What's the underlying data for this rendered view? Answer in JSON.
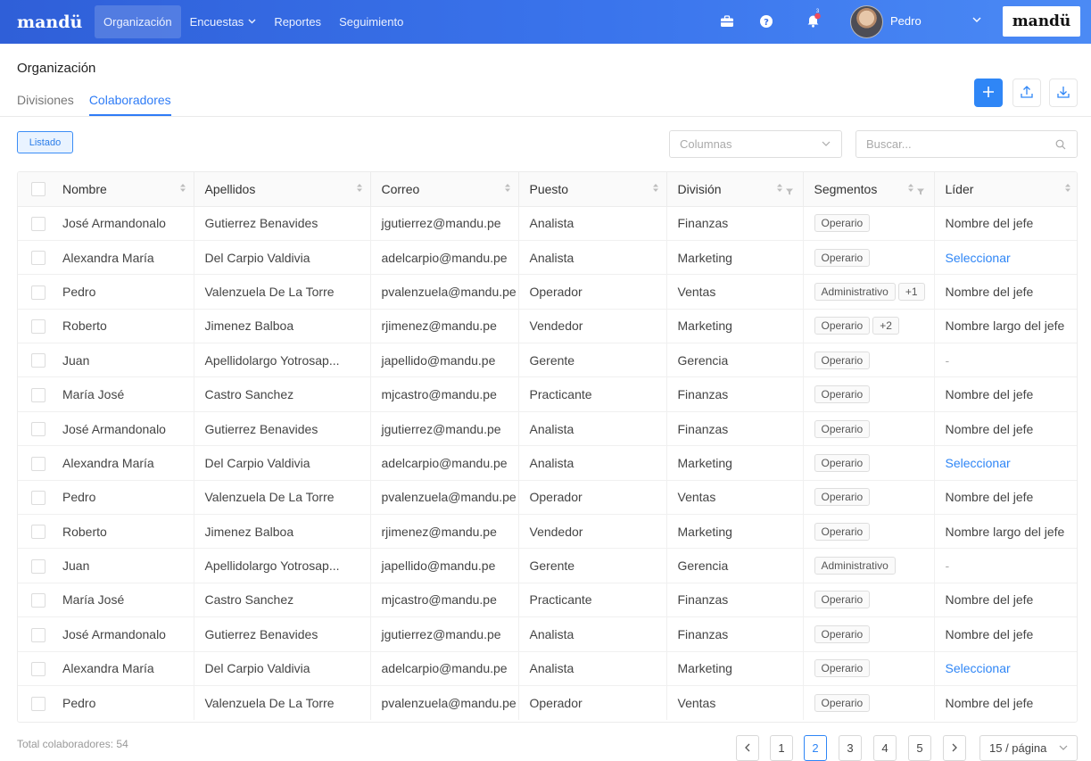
{
  "topbar": {
    "logo": "mandü",
    "nav": [
      {
        "label": "Organización",
        "active": true
      },
      {
        "label": "Encuestas",
        "chevron": "⌄"
      },
      {
        "label": "Reportes"
      },
      {
        "label": "Seguimiento"
      }
    ],
    "notification_badge": "3",
    "user_name": "Pedro",
    "brand_logo": "mandü",
    "colors": {
      "gradient_start": "#2f5fd8",
      "gradient_end": "#4b8af5"
    },
    "icons": [
      "briefcase-icon",
      "help-icon",
      "bell-icon",
      "avatar",
      "chevron-down-icon"
    ]
  },
  "page": {
    "title": "Organización",
    "tabs": [
      {
        "label": "Divisiones",
        "active": false
      },
      {
        "label": "Colaboradores",
        "active": true
      }
    ],
    "actions": [
      "add-icon",
      "upload-icon",
      "download-icon"
    ]
  },
  "toolbar": {
    "view_button": "Listado",
    "columns_select": "Columnas",
    "search_placeholder": "Buscar..."
  },
  "table": {
    "headers": [
      "Nombre",
      "Apellidos",
      "Correo",
      "Puesto",
      "División",
      "Segmentos",
      "Líder"
    ],
    "rows": [
      {
        "nombre": "José Armandonalo",
        "apellidos": "Gutierrez Benavides",
        "correo": "jgutierrez@mandu.pe",
        "puesto": "Analista",
        "division": "Finanzas",
        "segmentos": [
          "Operario"
        ],
        "lider": "Nombre del jefe",
        "lider_type": "text"
      },
      {
        "nombre": "Alexandra María",
        "apellidos": "Del Carpio Valdivia",
        "correo": "adelcarpio@mandu.pe",
        "puesto": "Analista",
        "division": "Marketing",
        "segmentos": [
          "Operario"
        ],
        "lider": "Seleccionar",
        "lider_type": "link"
      },
      {
        "nombre": "Pedro",
        "apellidos": "Valenzuela De La Torre",
        "correo": "pvalenzuela@mandu.pe",
        "puesto": "Operador",
        "division": "Ventas",
        "segmentos": [
          "Administrativo",
          "+1"
        ],
        "lider": "Nombre del jefe",
        "lider_type": "text"
      },
      {
        "nombre": "Roberto",
        "apellidos": "Jimenez Balboa",
        "correo": "rjimenez@mandu.pe",
        "puesto": "Vendedor",
        "division": "Marketing",
        "segmentos": [
          "Operario",
          "+2"
        ],
        "lider": "Nombre largo del jefe",
        "lider_type": "text"
      },
      {
        "nombre": "Juan",
        "apellidos": "Apellidolargo Yotrosap...",
        "correo": "japellido@mandu.pe",
        "puesto": "Gerente",
        "division": "Gerencia",
        "segmentos": [
          "Operario"
        ],
        "lider": "-",
        "lider_type": "muted"
      },
      {
        "nombre": "María José",
        "apellidos": "Castro Sanchez",
        "correo": "mjcastro@mandu.pe",
        "puesto": "Practicante",
        "division": "Finanzas",
        "segmentos": [
          "Operario"
        ],
        "lider": "Nombre del jefe",
        "lider_type": "text"
      },
      {
        "nombre": "José Armandonalo",
        "apellidos": "Gutierrez Benavides",
        "correo": "jgutierrez@mandu.pe",
        "puesto": "Analista",
        "division": "Finanzas",
        "segmentos": [
          "Operario"
        ],
        "lider": "Nombre del jefe",
        "lider_type": "text"
      },
      {
        "nombre": "Alexandra María",
        "apellidos": "Del Carpio Valdivia",
        "correo": "adelcarpio@mandu.pe",
        "puesto": "Analista",
        "division": "Marketing",
        "segmentos": [
          "Operario"
        ],
        "lider": "Seleccionar",
        "lider_type": "link"
      },
      {
        "nombre": "Pedro",
        "apellidos": "Valenzuela De La Torre",
        "correo": "pvalenzuela@mandu.pe",
        "puesto": "Operador",
        "division": "Ventas",
        "segmentos": [
          "Operario"
        ],
        "lider": "Nombre del jefe",
        "lider_type": "text"
      },
      {
        "nombre": "Roberto",
        "apellidos": "Jimenez Balboa",
        "correo": "rjimenez@mandu.pe",
        "puesto": "Vendedor",
        "division": "Marketing",
        "segmentos": [
          "Operario"
        ],
        "lider": "Nombre largo del jefe",
        "lider_type": "text"
      },
      {
        "nombre": "Juan",
        "apellidos": "Apellidolargo Yotrosap...",
        "correo": "japellido@mandu.pe",
        "puesto": "Gerente",
        "division": "Gerencia",
        "segmentos": [
          "Administrativo"
        ],
        "lider": "-",
        "lider_type": "muted"
      },
      {
        "nombre": "María José",
        "apellidos": "Castro Sanchez",
        "correo": "mjcastro@mandu.pe",
        "puesto": "Practicante",
        "division": "Finanzas",
        "segmentos": [
          "Operario"
        ],
        "lider": "Nombre del jefe",
        "lider_type": "text"
      },
      {
        "nombre": "José Armandonalo",
        "apellidos": "Gutierrez Benavides",
        "correo": "jgutierrez@mandu.pe",
        "puesto": "Analista",
        "division": "Finanzas",
        "segmentos": [
          "Operario"
        ],
        "lider": "Nombre del jefe",
        "lider_type": "text"
      },
      {
        "nombre": "Alexandra María",
        "apellidos": "Del Carpio Valdivia",
        "correo": "adelcarpio@mandu.pe",
        "puesto": "Analista",
        "division": "Marketing",
        "segmentos": [
          "Operario"
        ],
        "lider": "Seleccionar",
        "lider_type": "link"
      },
      {
        "nombre": "Pedro",
        "apellidos": "Valenzuela De La Torre",
        "correo": "pvalenzuela@mandu.pe",
        "puesto": "Operador",
        "division": "Ventas",
        "segmentos": [
          "Operario"
        ],
        "lider": "Nombre del jefe",
        "lider_type": "text"
      }
    ]
  },
  "footer": {
    "total": "Total colaboradores: 54",
    "pages": [
      "1",
      "2",
      "3",
      "4",
      "5"
    ],
    "current_page": "2",
    "page_size": "15 / página"
  }
}
